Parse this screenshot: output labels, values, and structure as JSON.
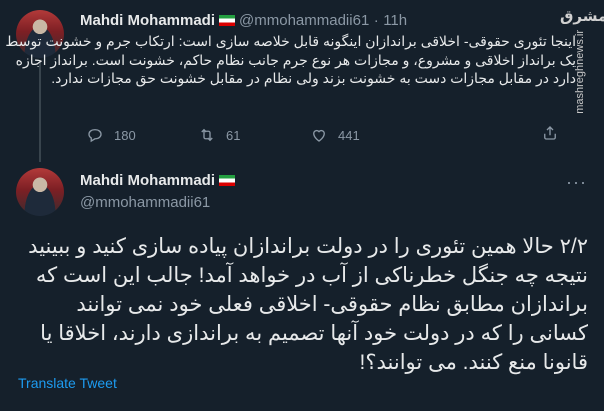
{
  "tweet1": {
    "author_name": "Mahdi Mohammadi",
    "handle": "@mmohammadii61",
    "separator": "·",
    "time": "11h",
    "text": "اینجا تئوری حقوقی- اخلاقی براندازان اینگونه قابل خلاصه سازی است: ارتکاب جرم و خشونت توسط یک برانداز اخلاقی و مشروع، و مجازات هر نوع جرم جانب نظام حاکم، خشونت است. برانداز اجازه دارد در مقابل مجازات دست به خشونت بزند ولی نظام در مقابل خشونت حق مجازات ندارد.",
    "replies": "180",
    "retweets": "61",
    "likes": "441"
  },
  "watermark": {
    "logo": "مشرق",
    "site": "mashreghnews.ir"
  },
  "tweet2": {
    "author_name": "Mahdi Mohammadi",
    "handle": "@mmohammadii61",
    "more": "···",
    "text": "۲/۲ حالا همین تئوری را در دولت براندازان پیاده سازی کنید و ببینید نتیجه چه جنگل خطرناکی از آب در خواهد آمد! جالب این است که براندازان مطابق نظام حقوقی- اخلاقی فعلی خود نمی توانند کسانی را که در دولت خود آنها تصمیم به براندازی دارند، اخلاقا یا قانونا منع کنند. می توانند؟!",
    "translate": "Translate Tweet"
  },
  "colors": {
    "background": "#15202b",
    "text": "#e7e9ea",
    "muted": "#8b98a5",
    "link": "#1d9bf0"
  },
  "icons": [
    "reply-icon",
    "retweet-icon",
    "like-icon",
    "share-icon",
    "more-icon",
    "iran-flag-icon"
  ]
}
